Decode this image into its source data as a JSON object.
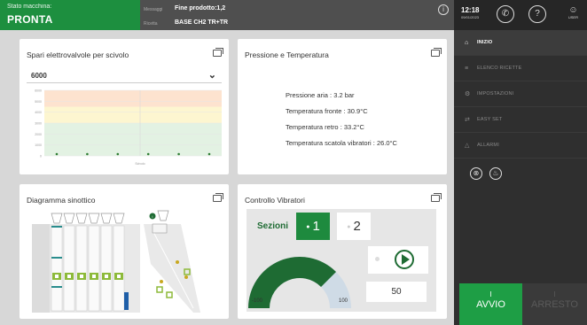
{
  "topbar": {
    "status_label": "Stato macchina:",
    "status_value": "PRONTA",
    "message_label": "Messaggi",
    "message_value": "Fine prodotto:1,2",
    "ricetta_label": "Ricetta",
    "ricetta_value": "BASE CH2 TR+TR",
    "info_glyph": "i"
  },
  "clock": {
    "time": "12:18",
    "date": "09/01/2023"
  },
  "right_header": {
    "phone_glyph": "✆",
    "help_glyph": "?",
    "user_label": "USER"
  },
  "nav": {
    "items": [
      {
        "label": "INIZIO",
        "icon": "⌂"
      },
      {
        "label": "ELENCO RICETTE",
        "icon": "≡"
      },
      {
        "label": "IMPOSTAZIONI",
        "icon": "⚙"
      },
      {
        "label": "EASY SET",
        "icon": "⇄"
      },
      {
        "label": "ALLARMI",
        "icon": "△"
      }
    ]
  },
  "mini_icons": [
    "⊗",
    "♨"
  ],
  "actions": {
    "avvio_bar": "I",
    "avvio": "AVVIO",
    "arresto_bar": "I",
    "arresto": "ARRESTO"
  },
  "card1": {
    "title": "Spari elettrovalvole per scivolo",
    "dropdown_value": "6000",
    "x_axis_label": "Scivolo"
  },
  "card2": {
    "title": "Pressione e Temperatura",
    "lines": [
      "Pressione aria : 3.2 bar",
      "Temperatura fronte : 30.9°C",
      "Temperatura retro : 33.2°C",
      "Temperatura scatola vibratori : 26.0°C"
    ]
  },
  "card3": {
    "title": "Diagramma sinottico"
  },
  "card4": {
    "title": "Controllo Vibratori",
    "sezioni_label": "Sezioni",
    "sezione1": "1",
    "sezione2": "2",
    "gauge_min": "-100",
    "gauge_max": "100",
    "gauge_value": 50,
    "value_display": "50"
  },
  "chart_data": {
    "type": "scatter",
    "title": "Spari elettrovalvole per scivolo",
    "xlabel": "Scivolo",
    "y_ticks": [
      "6000",
      "5000",
      "4000",
      "3000",
      "2000",
      "1000",
      "0"
    ],
    "x": [
      1,
      2,
      3,
      4,
      5,
      6
    ],
    "values": [
      0,
      0,
      0,
      0,
      0,
      0
    ],
    "ylim": [
      0,
      6000
    ],
    "bands": [
      {
        "from": 4500,
        "to": 6000,
        "color": "#fde3cf"
      },
      {
        "from": 3000,
        "to": 4500,
        "color": "#fdf6d0"
      },
      {
        "from": 0,
        "to": 3000,
        "color": "#e3f2e3"
      }
    ],
    "point_color": "#2e7d32",
    "grid": true
  },
  "colors": {
    "accent_green": "#1e8a3e",
    "dark_green": "#1e6b33",
    "status_green": "#1d8f3f",
    "panel_dark": "#2f2f2f"
  }
}
